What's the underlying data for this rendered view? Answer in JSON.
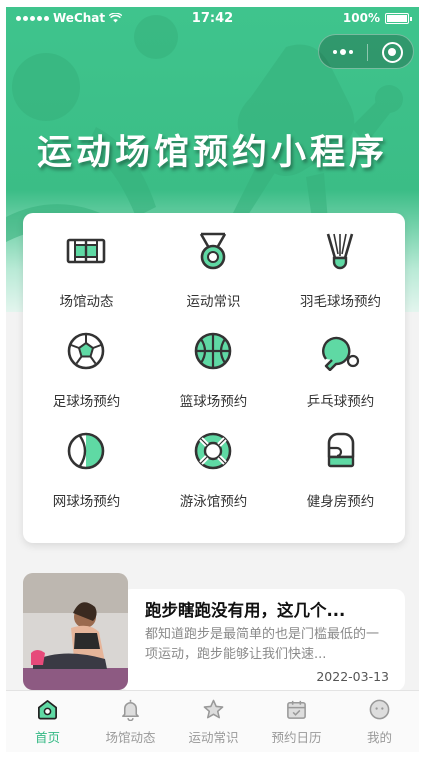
{
  "status_bar": {
    "carrier": "WeChat",
    "time": "17:42",
    "battery": "100%"
  },
  "capsule": {
    "more_icon": "more-dots-icon",
    "close_icon": "target-close-icon"
  },
  "header": {
    "title": "运动场馆预约小程序"
  },
  "grid": {
    "items": [
      {
        "label": "场馆动态",
        "icon": "court-icon"
      },
      {
        "label": "运动常识",
        "icon": "medal-icon"
      },
      {
        "label": "羽毛球场预约",
        "icon": "shuttlecock-icon"
      },
      {
        "label": "足球场预约",
        "icon": "football-icon"
      },
      {
        "label": "篮球场预约",
        "icon": "basketball-icon"
      },
      {
        "label": "乒乓球预约",
        "icon": "ping-pong-icon"
      },
      {
        "label": "网球场预约",
        "icon": "tennis-icon"
      },
      {
        "label": "游泳馆预约",
        "icon": "lifebuoy-icon"
      },
      {
        "label": "健身房预约",
        "icon": "boxing-glove-icon"
      }
    ]
  },
  "article": {
    "title": "跑步瞎跑没有用，这几个...",
    "description": "都知道跑步是最简单的也是门槛最低的一项运动，跑步能够让我们快速...",
    "date": "2022-03-13"
  },
  "tabbar": {
    "items": [
      {
        "label": "首页",
        "icon": "home-icon",
        "active": true
      },
      {
        "label": "场馆动态",
        "icon": "bell-icon",
        "active": false
      },
      {
        "label": "运动常识",
        "icon": "star-icon",
        "active": false
      },
      {
        "label": "预约日历",
        "icon": "calendar-icon",
        "active": false
      },
      {
        "label": "我的",
        "icon": "profile-icon",
        "active": false
      }
    ]
  },
  "colors": {
    "brand": "#3fc48d",
    "accent": "#5fd9a4",
    "active_tab": "#35b985"
  }
}
